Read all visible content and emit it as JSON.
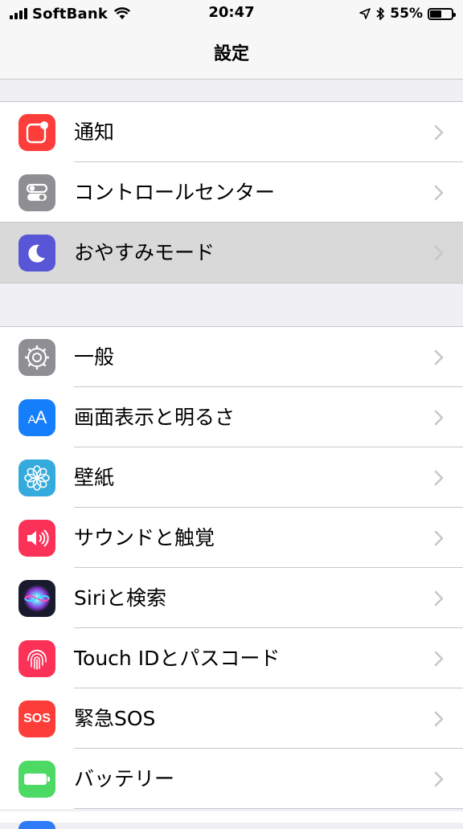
{
  "status_bar": {
    "carrier": "SoftBank",
    "time": "20:47",
    "battery_percent": "55%",
    "battery_level": 0.55
  },
  "nav": {
    "title": "設定"
  },
  "groups": [
    {
      "items": [
        {
          "label": "通知",
          "icon": "notifications-icon",
          "color": "#fc3d39",
          "selected": false
        },
        {
          "label": "コントロールセンター",
          "icon": "control-center-icon",
          "color": "#8e8e93",
          "selected": false
        },
        {
          "label": "おやすみモード",
          "icon": "moon-icon",
          "color": "#5856d6",
          "selected": true
        }
      ]
    },
    {
      "items": [
        {
          "label": "一般",
          "icon": "gear-icon",
          "color": "#8e8e93"
        },
        {
          "label": "画面表示と明るさ",
          "icon": "display-brightness-icon",
          "color": "#147efb",
          "glyph": "AA"
        },
        {
          "label": "壁紙",
          "icon": "wallpaper-flower-icon",
          "color": "#35aadc"
        },
        {
          "label": "サウンドと触覚",
          "icon": "speaker-icon",
          "color": "#fc3158"
        },
        {
          "label": "Siriと検索",
          "icon": "siri-icon",
          "color": "#1a1a2e"
        },
        {
          "label": "Touch IDとパスコード",
          "icon": "fingerprint-icon",
          "color": "#fc3158"
        },
        {
          "label": "緊急SOS",
          "icon": "sos-icon",
          "color": "#fc3d39",
          "glyph": "SOS"
        },
        {
          "label": "バッテリー",
          "icon": "battery-icon",
          "color": "#4cd964"
        }
      ]
    }
  ]
}
